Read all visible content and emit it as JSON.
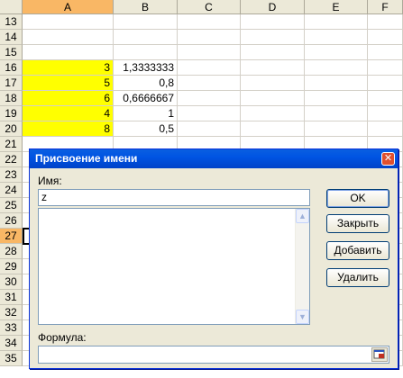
{
  "spreadsheet": {
    "columns": [
      "A",
      "B",
      "C",
      "D",
      "E",
      "F"
    ],
    "selected_column": "A",
    "rows": [
      "13",
      "14",
      "15",
      "16",
      "17",
      "18",
      "19",
      "20",
      "21",
      "22",
      "23",
      "24",
      "25",
      "26",
      "27",
      "28",
      "29",
      "30",
      "31",
      "32",
      "33",
      "34",
      "35"
    ],
    "selected_row": "27",
    "cells": [
      {
        "row": "16",
        "a": "3",
        "b": "1,3333333"
      },
      {
        "row": "17",
        "a": "5",
        "b": "0,8"
      },
      {
        "row": "18",
        "a": "6",
        "b": "0,6666667"
      },
      {
        "row": "19",
        "a": "4",
        "b": "1"
      },
      {
        "row": "20",
        "a": "8",
        "b": "0,5"
      }
    ],
    "highlight_color": "#ffff00",
    "selection_header_color": "#f9b765"
  },
  "dialog": {
    "title": "Присвоение имени",
    "close_icon": "close-icon",
    "name_label": "Имя:",
    "name_value": "z",
    "formula_label": "Формула:",
    "formula_value": "",
    "buttons": {
      "ok": "OK",
      "close": "Закрыть",
      "add": "Добавить",
      "delete": "Удалить"
    },
    "title_color": "#0054e3"
  }
}
